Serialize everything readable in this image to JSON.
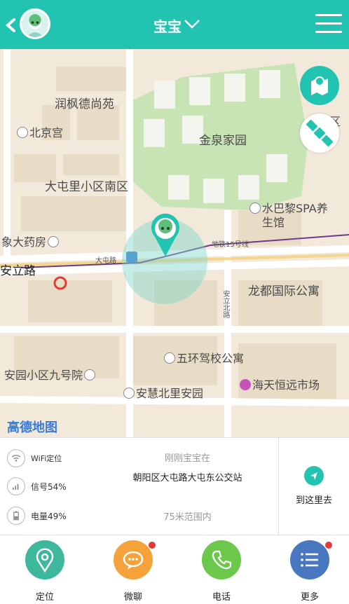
{
  "header": {
    "title": "宝宝",
    "back_icon": "back-arrow-icon",
    "menu_icon": "hamburger-menu-icon",
    "accent_color": "#22c4b1"
  },
  "map": {
    "labels": {
      "runfeng": "润枫德尚苑",
      "beijinggong": "北京宫",
      "jinquan": "金泉家园",
      "datunli": "大屯里小区南区",
      "pharmacy": "象大药房",
      "shuibali": "水巴黎SPA养",
      "shuibali2": "生馆",
      "anli_road": "安立路",
      "metro15": "地铁15号线",
      "datunlu": "大屯路",
      "longdu": "龙都国际公寓",
      "anlibei": "安立北路",
      "wuhuan": "五环驾校公寓",
      "anyuan9": "安园小区九号院",
      "haitian": "海天恒远市场",
      "anhuibei": "安慧北里安园",
      "community": "区",
      "logo": "高德地图"
    },
    "fab_location_icon": "map-pin-icon",
    "fab_satellite_icon": "satellite-icon"
  },
  "info": {
    "wifi_label": "WiFi定位",
    "signal_label": "信号54%",
    "battery_label": "电量49%",
    "status_top": "刚刚宝宝在",
    "address": "朝阳区大屯路大屯东公交站",
    "range": "75米范围内",
    "goto_label": "到这里去"
  },
  "nav": [
    {
      "label": "定位",
      "color": "#3db89d"
    },
    {
      "label": "微聊",
      "color": "#f5a23a"
    },
    {
      "label": "电话",
      "color": "#6cc84a"
    },
    {
      "label": "更多",
      "color": "#4a78c0"
    }
  ]
}
